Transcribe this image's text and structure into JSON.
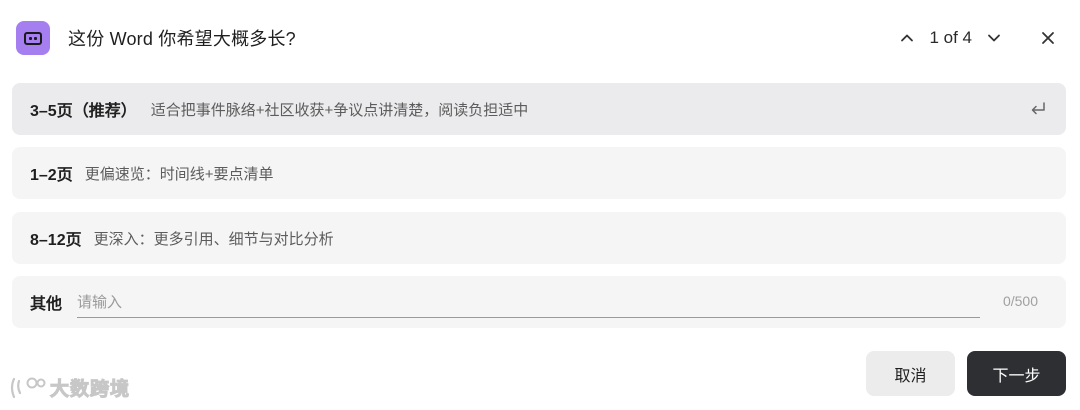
{
  "dialog": {
    "title": "这份 Word 你希望大概多长?",
    "pager": "1 of 4",
    "icons": {
      "app": "robot-face-icon",
      "prev": "chevron-up-icon",
      "next": "chevron-down-icon",
      "close": "close-icon",
      "enter": "enter-return-icon"
    }
  },
  "options": [
    {
      "label": "3–5页（推荐）",
      "desc": "适合把事件脉络+社区收获+争议点讲清楚，阅读负担适中",
      "selected": true
    },
    {
      "label": "1–2页",
      "desc": "更偏速览：时间线+要点清单",
      "selected": false
    },
    {
      "label": "8–12页",
      "desc": "更深入：更多引用、细节与对比分析",
      "selected": false
    }
  ],
  "other": {
    "label": "其他",
    "placeholder": "请输入",
    "value": "",
    "counter": "0/500"
  },
  "buttons": {
    "cancel": "取消",
    "next": "下一步"
  },
  "watermark": {
    "text": "大数跨境"
  },
  "colors": {
    "app_icon_bg": "#a57ef0",
    "selected_option_bg": "#ebebed",
    "option_bg": "#f5f5f6",
    "primary_button": "#2d2f33"
  }
}
